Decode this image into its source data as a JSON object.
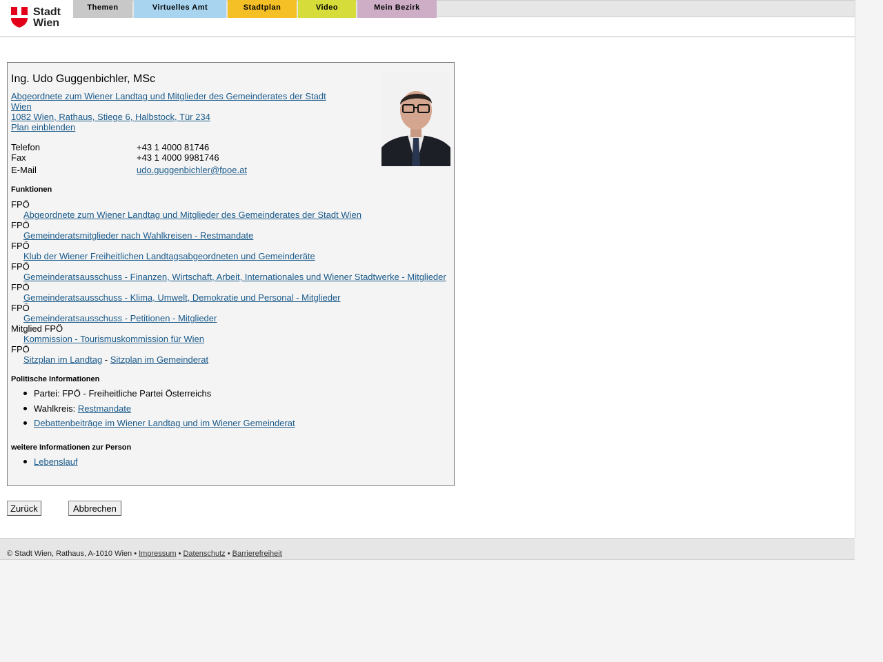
{
  "logo": {
    "line1": "Stadt",
    "line2": "Wien"
  },
  "nav": {
    "tabs": [
      {
        "label": "Themen",
        "color": "#c8c8c8"
      },
      {
        "label": "Virtuelles Amt",
        "color": "#a8d4f0"
      },
      {
        "label": "Stadtplan",
        "color": "#f5c026"
      },
      {
        "label": "Video",
        "color": "#d6dd3a"
      },
      {
        "label": "Mein Bezirk",
        "color": "#cdaec6"
      }
    ]
  },
  "person": {
    "name": "Ing. Udo Guggenbichler, MSc",
    "role_line1": "Abgeordnete zum Wiener Landtag und Mitglieder des Gemeinderates der Stadt",
    "role_line2": "Wien ",
    "address": "1082 Wien, Rathaus, Stiege 6, Halbstock, Tür 234",
    "map_link": "Plan einblenden",
    "contacts": [
      {
        "label": "Telefon",
        "value": "+43 1 4000 81746"
      },
      {
        "label": "Fax",
        "value": "+43 1 4000 9981746"
      },
      {
        "label": "E-Mail",
        "value": "udo.guggenbichler@fpoe.at"
      }
    ]
  },
  "functions": {
    "title": "Funktionen",
    "items": [
      {
        "party": "FPÖ",
        "link": "Abgeordnete zum Wiener Landtag und Mitglieder des Gemeinderates der Stadt Wien"
      },
      {
        "party": "FPÖ",
        "link": "Gemeinderatsmitglieder nach Wahlkreisen - Restmandate"
      },
      {
        "party": "FPÖ",
        "link": "Klub der Wiener Freiheitlichen Landtagsabgeordneten und Gemeinderäte"
      },
      {
        "party": "FPÖ",
        "link": "Gemeinderatsausschuss - Finanzen, Wirtschaft, Arbeit, Internationales und Wiener Stadtwerke - Mitglieder"
      },
      {
        "party": "FPÖ",
        "link": "Gemeinderatsausschuss - Klima, Umwelt, Demokratie und Personal - Mitglieder"
      },
      {
        "party": "FPÖ",
        "link": "Gemeinderatsausschuss - Petitionen - Mitglieder"
      },
      {
        "party": "Mitglied FPÖ",
        "link": "Kommission - Tourismuskommission für Wien"
      }
    ],
    "seating": {
      "party": "FPÖ",
      "link1": "Sitzplan im Landtag",
      "separator": " - ",
      "link2": "Sitzplan im Gemeinderat"
    }
  },
  "political": {
    "title": "Politische Informationen",
    "party_label": "Partei: FPÖ - Freiheitliche Partei Österreichs",
    "wahlkreis_prefix": "Wahlkreis: ",
    "wahlkreis_link": "Restmandate",
    "debates_link": "Debattenbeiträge im Wiener Landtag und im Wiener Gemeinderat"
  },
  "more_info": {
    "title": "weitere Informationen zur Person",
    "link": "Lebenslauf"
  },
  "buttons": {
    "back": "Zurück",
    "cancel": "Abbrechen"
  },
  "footer": {
    "copyright": "© Stadt Wien, Rathaus, A-1010 Wien • ",
    "impressum": "Impressum",
    "sep": " • ",
    "datenschutz": "Datenschutz",
    "barrierefreiheit": "Barrierefreiheit"
  }
}
